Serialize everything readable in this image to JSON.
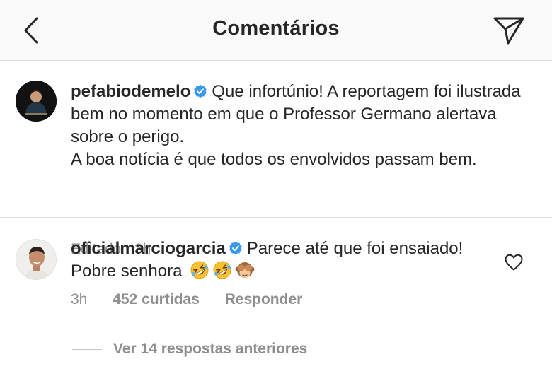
{
  "header": {
    "title": "Comentários",
    "back_icon": "chevron-left-icon",
    "send_icon": "paper-plane-icon"
  },
  "caption": {
    "username": "pefabiodemelo",
    "verified": true,
    "text_line1": "Que infortúnio! A reportagem foi ilustrada bem no momento em que o Professor Germano alertava sobre o perigo.",
    "text_line2": "A boa notícia é que todos os envolvidos passam bem.",
    "edited_label": "Editado",
    "separator": "·",
    "time": "3h"
  },
  "comment": {
    "username": "oficialmarciogarcia",
    "verified": true,
    "text": "Parece até que foi ensaiado! Pobre senhora",
    "emojis": [
      "rolling-on-floor-laughing-emoji",
      "rolling-on-floor-laughing-emoji",
      "see-no-evil-monkey-emoji"
    ],
    "time": "3h",
    "likes": "452 curtidas",
    "reply_label": "Responder"
  },
  "replies": {
    "label": "Ver 14 respostas anteriores"
  },
  "colors": {
    "text": "#262626",
    "secondary": "#8e8e8e",
    "verified": "#3897f0",
    "divider": "#dbdbdb",
    "header_bg": "#fafafa"
  }
}
